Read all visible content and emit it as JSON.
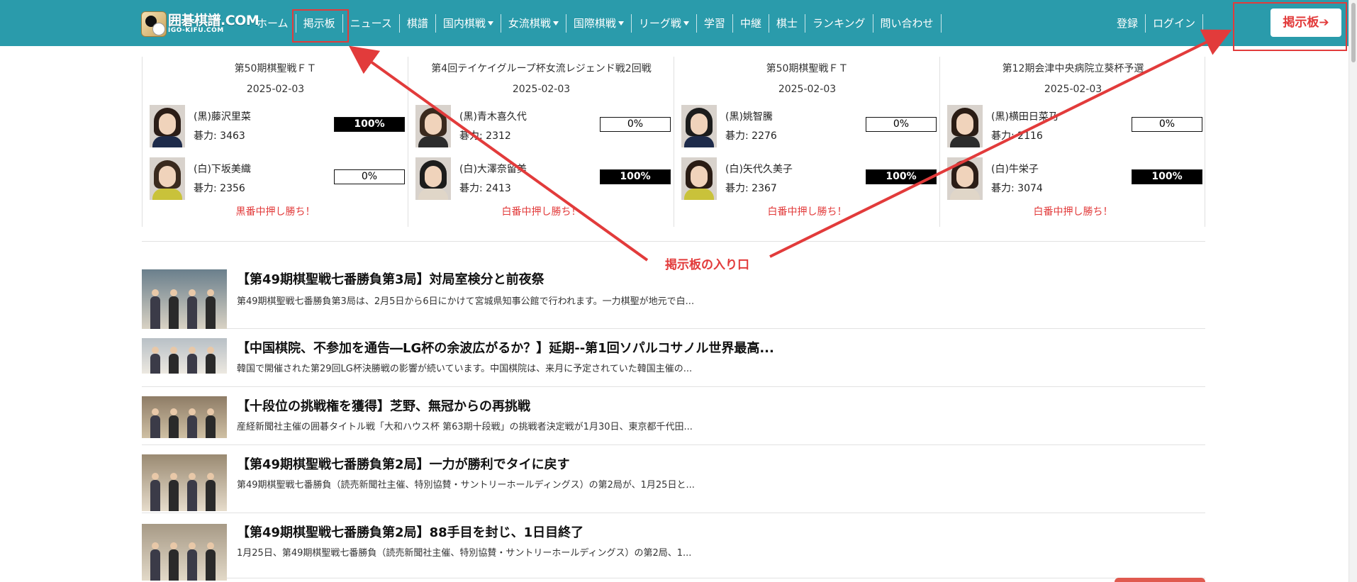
{
  "header": {
    "logo": {
      "main": "囲碁棋譜.COM",
      "sub": "IGO-KIFU.COM"
    },
    "nav": [
      {
        "label": "ホーム",
        "dropdown": false
      },
      {
        "label": "掲示板",
        "dropdown": false
      },
      {
        "label": "ニュース",
        "dropdown": false
      },
      {
        "label": "棋譜",
        "dropdown": false
      },
      {
        "label": "国内棋戦",
        "dropdown": true
      },
      {
        "label": "女流棋戦",
        "dropdown": true
      },
      {
        "label": "国際棋戦",
        "dropdown": true
      },
      {
        "label": "リーグ戦",
        "dropdown": true
      },
      {
        "label": "学習",
        "dropdown": false
      },
      {
        "label": "中継",
        "dropdown": false
      },
      {
        "label": "棋士",
        "dropdown": false
      },
      {
        "label": "ランキング",
        "dropdown": false
      },
      {
        "label": "問い合わせ",
        "dropdown": false
      }
    ],
    "auth": {
      "register": "登録",
      "login": "ログイン"
    },
    "bbs_button": "掲示板➔"
  },
  "colors": {
    "topbar": "#2a9bab",
    "accent_red": "#e23b3b"
  },
  "games": [
    {
      "title": "第50期棋聖戦ＦＴ",
      "date": "2025-02-03",
      "black": {
        "name": "(黒)藤沢里菜",
        "rating": "碁力: 3463",
        "percent": "100%",
        "percent_value": 1.0
      },
      "white": {
        "name": "(白)下坂美織",
        "rating": "碁力: 2356",
        "percent": "0%",
        "percent_value": 0.0
      },
      "result": "黒番中押し勝ち！"
    },
    {
      "title": "第4回テイケイグループ杯女流レジェンド戦2回戦",
      "date": "2025-02-03",
      "black": {
        "name": "(黒)青木喜久代",
        "rating": "碁力: 2312",
        "percent": "0%",
        "percent_value": 0.0
      },
      "white": {
        "name": "(白)大澤奈留美",
        "rating": "碁力: 2413",
        "percent": "100%",
        "percent_value": 1.0
      },
      "result": "白番中押し勝ち！"
    },
    {
      "title": "第50期棋聖戦ＦＴ",
      "date": "2025-02-03",
      "black": {
        "name": "(黒)姚智騰",
        "rating": "碁力: 2276",
        "percent": "0%",
        "percent_value": 0.0
      },
      "white": {
        "name": "(白)矢代久美子",
        "rating": "碁力: 2367",
        "percent": "100%",
        "percent_value": 1.0
      },
      "result": "白番中押し勝ち！"
    },
    {
      "title": "第12期会津中央病院立葵杯予選",
      "date": "2025-02-03",
      "black": {
        "name": "(黒)横田日菜乃",
        "rating": "碁力: 2116",
        "percent": "0%",
        "percent_value": 0.0
      },
      "white": {
        "name": "(白)牛栄子",
        "rating": "碁力: 3074",
        "percent": "100%",
        "percent_value": 1.0
      },
      "result": "白番中押し勝ち！"
    }
  ],
  "news": [
    {
      "title": "【第49期棋聖戦七番勝負第3局】対局室検分と前夜祭",
      "summary": "第49期棋聖戦七番勝負第3局は、2月5日から6日にかけて宮城県知事公館で行われます。一力棋聖が地元で白..."
    },
    {
      "title": "【中国棋院、不参加を通告―LG杯の余波広がるか？】延期--第1回ソパルコサノル世界最高...",
      "summary": "韓国で開催された第29回LG杯決勝戦の影響が続いています。中国棋院は、来月に予定されていた韓国主催の..."
    },
    {
      "title": "【十段位の挑戦権を獲得】芝野、無冠からの再挑戦",
      "summary": "産経新聞社主催の囲碁タイトル戦「大和ハウス杯 第63期十段戦」の挑戦者決定戦が1月30日、東京都千代田..."
    },
    {
      "title": "【第49期棋聖戦七番勝負第2局】一力が勝利でタイに戻す",
      "summary": "第49期棋聖戦七番勝負（読売新聞社主催、特別協賛・サントリーホールディングス）の第2局が、1月25日と..."
    },
    {
      "title": "【第49期棋聖戦七番勝負第2局】88手目を封じ、1日目終了",
      "summary": "1月25日、第49期棋聖戦七番勝負（読売新聞社主催、特別協賛・サントリーホールディングス）の第2局、1..."
    }
  ],
  "annotation": {
    "label": "掲示板の入り口"
  }
}
